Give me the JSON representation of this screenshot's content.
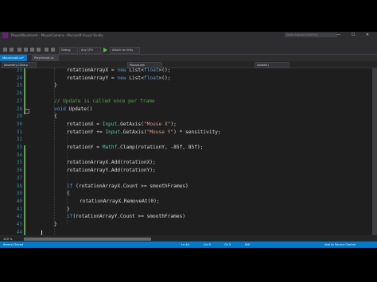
{
  "window": {
    "title": "PlayerMovement - MouseCamera - Microsoft Visual Studio",
    "quick_launch_placeholder": "Quick Launch (Ctrl+Q)",
    "controls": "— ☐ ✕"
  },
  "menu": [
    "File",
    "Edit",
    "View",
    "Project",
    "Build",
    "Debug",
    "Team",
    "Tools",
    "Test",
    "Analyze",
    "Window",
    "Help"
  ],
  "toolbar": {
    "config": "Debug",
    "platform": "Any CPU",
    "attach": "Attach to Unity"
  },
  "tabs": [
    {
      "label": "MouseLook.cs*",
      "active": true
    },
    {
      "label": "PlayerLook.cs",
      "active": false
    }
  ],
  "navbar": {
    "project": "Assembly-CSharp",
    "class": "MouseLook",
    "member": "Update()"
  },
  "code": {
    "lines": [
      {
        "num": "23",
        "tokens": [
          {
            "t": "rotationArrayX = ",
            "c": ""
          },
          {
            "t": "new",
            "c": "kw"
          },
          {
            "t": " List<",
            "c": ""
          },
          {
            "t": "float",
            "c": "kw"
          },
          {
            "t": ">();",
            "c": ""
          }
        ],
        "indent": 84
      },
      {
        "num": "24",
        "tokens": [
          {
            "t": "rotationArrayY = ",
            "c": ""
          },
          {
            "t": "new",
            "c": "kw"
          },
          {
            "t": " List<",
            "c": ""
          },
          {
            "t": "float",
            "c": "kw"
          },
          {
            "t": ">();",
            "c": ""
          }
        ],
        "indent": 84
      },
      {
        "num": "25",
        "tokens": [
          {
            "t": "}",
            "c": ""
          }
        ],
        "indent": 68
      },
      {
        "num": "26",
        "tokens": [],
        "indent": 68
      },
      {
        "num": "27",
        "tokens": [
          {
            "t": "// Update is called once per frame",
            "c": "com"
          }
        ],
        "indent": 68
      },
      {
        "num": "28",
        "tokens": [
          {
            "t": "void",
            "c": "kw"
          },
          {
            "t": " Update()",
            "c": ""
          }
        ],
        "indent": 68
      },
      {
        "num": "29",
        "tokens": [
          {
            "t": "{",
            "c": ""
          }
        ],
        "indent": 68
      },
      {
        "num": "30",
        "tokens": [
          {
            "t": "rotationX = ",
            "c": ""
          },
          {
            "t": "Input",
            "c": "type"
          },
          {
            "t": ".GetAxis(",
            "c": ""
          },
          {
            "t": "\"Mouse X\"",
            "c": "str"
          },
          {
            "t": ");",
            "c": ""
          }
        ],
        "indent": 84
      },
      {
        "num": "31",
        "tokens": [
          {
            "t": "rotationY += ",
            "c": ""
          },
          {
            "t": "Input",
            "c": "type"
          },
          {
            "t": ".GetAxis(",
            "c": ""
          },
          {
            "t": "\"Mouse Y\"",
            "c": "str"
          },
          {
            "t": ") * sensitivity;",
            "c": ""
          }
        ],
        "indent": 84
      },
      {
        "num": "32",
        "tokens": [],
        "indent": 84
      },
      {
        "num": "33",
        "tokens": [
          {
            "t": "rotationY = ",
            "c": ""
          },
          {
            "t": "Mathf",
            "c": "type"
          },
          {
            "t": ".Clamp(rotationY, -85f, 85f);",
            "c": ""
          }
        ],
        "indent": 84
      },
      {
        "num": "34",
        "tokens": [],
        "indent": 84
      },
      {
        "num": "35",
        "tokens": [
          {
            "t": "rotationArrayX.Add(rotationX);",
            "c": ""
          }
        ],
        "indent": 84
      },
      {
        "num": "36",
        "tokens": [
          {
            "t": "rotationArrayY.Add(rotationY);",
            "c": ""
          }
        ],
        "indent": 84
      },
      {
        "num": "37",
        "tokens": [],
        "indent": 84
      },
      {
        "num": "38",
        "tokens": [
          {
            "t": "if",
            "c": "kw"
          },
          {
            "t": " (rotationArrayX.Count >= smoothFrames)",
            "c": ""
          }
        ],
        "indent": 84
      },
      {
        "num": "39",
        "tokens": [
          {
            "t": "{",
            "c": ""
          }
        ],
        "indent": 84
      },
      {
        "num": "40",
        "tokens": [
          {
            "t": "rotationArrayX.RemoveAt(0);",
            "c": ""
          }
        ],
        "indent": 100
      },
      {
        "num": "41",
        "tokens": [
          {
            "t": "}",
            "c": ""
          }
        ],
        "indent": 84
      },
      {
        "num": "42",
        "tokens": [
          {
            "t": "if",
            "c": "kw"
          },
          {
            "t": "(rotationArrayY.Count >= smoothFrames)",
            "c": ""
          }
        ],
        "indent": 84
      },
      {
        "num": "43",
        "tokens": [
          {
            "t": "}",
            "c": ""
          }
        ],
        "indent": 68
      },
      {
        "num": "44",
        "tokens": [],
        "indent": 52
      }
    ]
  },
  "editor_footer": {
    "zoom": "100 %"
  },
  "status": {
    "left": "Item(s) Saved",
    "ln": "Ln 44",
    "col": "Col 5",
    "ch": "Ch 5",
    "mode": "INS",
    "source_control": "Add to Source Control"
  },
  "colors": {
    "accent": "#007acc",
    "keyword": "#569cd6",
    "type": "#4ec9b0",
    "string": "#d69d85",
    "comment": "#57a64a",
    "line_number": "#2b91af"
  }
}
